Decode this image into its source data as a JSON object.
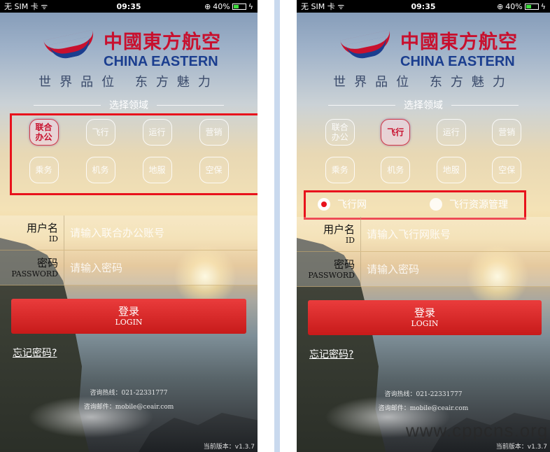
{
  "status_bar": {
    "carrier": "无 SIM 卡 ᯤ",
    "time": "09:35",
    "battery": "40%"
  },
  "brand": {
    "cn": "中國東方航空",
    "en": "CHINA EASTERN",
    "slogan": "世界品位 东方魅力"
  },
  "section_title": "选择领域",
  "domains_left": [
    "联合办公",
    "飞行",
    "运行",
    "营销",
    "乘务",
    "机务",
    "地服",
    "空保"
  ],
  "domains_left_lines": [
    [
      "联合",
      "办公"
    ],
    [
      "飞行"
    ],
    [
      "运行"
    ],
    [
      "营销"
    ],
    [
      "乘务"
    ],
    [
      "机务"
    ],
    [
      "地服"
    ],
    [
      "空保"
    ]
  ],
  "domains_right_lines": [
    [
      "联合",
      "办公"
    ],
    [
      "飞行"
    ],
    [
      "运行"
    ],
    [
      "营销"
    ],
    [
      "乘务"
    ],
    [
      "机务"
    ],
    [
      "地服"
    ],
    [
      "空保"
    ]
  ],
  "left_selected": "联合办公",
  "right_selected": "飞行",
  "right_options": {
    "selected": "飞行网",
    "other": "飞行资源管理"
  },
  "left_form": {
    "user_label": "用户名",
    "user_sub": "ID",
    "user_placeholder": "请输入联合办公账号",
    "pwd_label": "密码",
    "pwd_sub": "PASSWORD",
    "pwd_placeholder": "请输入密码"
  },
  "right_form": {
    "user_label": "用户名",
    "user_sub": "ID",
    "user_placeholder": "请输入飞行网账号",
    "pwd_label": "密码",
    "pwd_sub": "PASSWORD",
    "pwd_placeholder": "请输入密码"
  },
  "login": {
    "cn": "登录",
    "en": "LOGIN"
  },
  "forgot": "忘记密码?",
  "contact": {
    "hotline": "咨询热线：021-22331777",
    "email": "咨询邮件：mobile@ceair.com"
  },
  "version": "当前版本：v1.3.7",
  "watermark": "www.cppcns.org",
  "colors": {
    "brand_red": "#c8102e",
    "brand_blue": "#1b3e8f",
    "highlight": "#e8121c"
  }
}
